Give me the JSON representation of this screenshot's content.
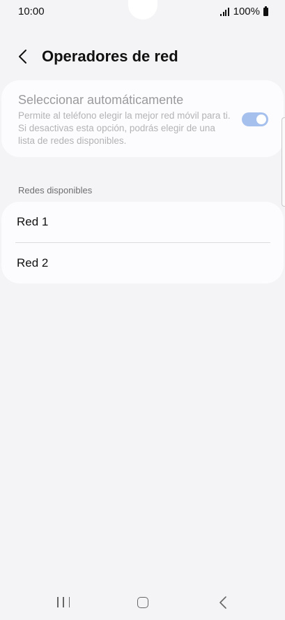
{
  "status_bar": {
    "time": "10:00",
    "battery": "100%",
    "icons": [
      "signal-icon",
      "battery-icon"
    ]
  },
  "header": {
    "title": "Operadores de red",
    "back_icon": "chevron-left-icon"
  },
  "auto_select": {
    "title": "Seleccionar automáticamente",
    "description": "Permite al teléfono elegir la mejor red móvil para ti. Si desactivas esta opción, podrás elegir de una lista de redes disponibles.",
    "enabled": true,
    "toggle_color": "#a6c0ee"
  },
  "networks": {
    "section_label": "Redes disponibles",
    "items": [
      {
        "label": "Red 1"
      },
      {
        "label": "Red 2"
      }
    ]
  },
  "nav_bar": {
    "icons": [
      "recents-icon",
      "home-icon",
      "back-icon"
    ]
  }
}
